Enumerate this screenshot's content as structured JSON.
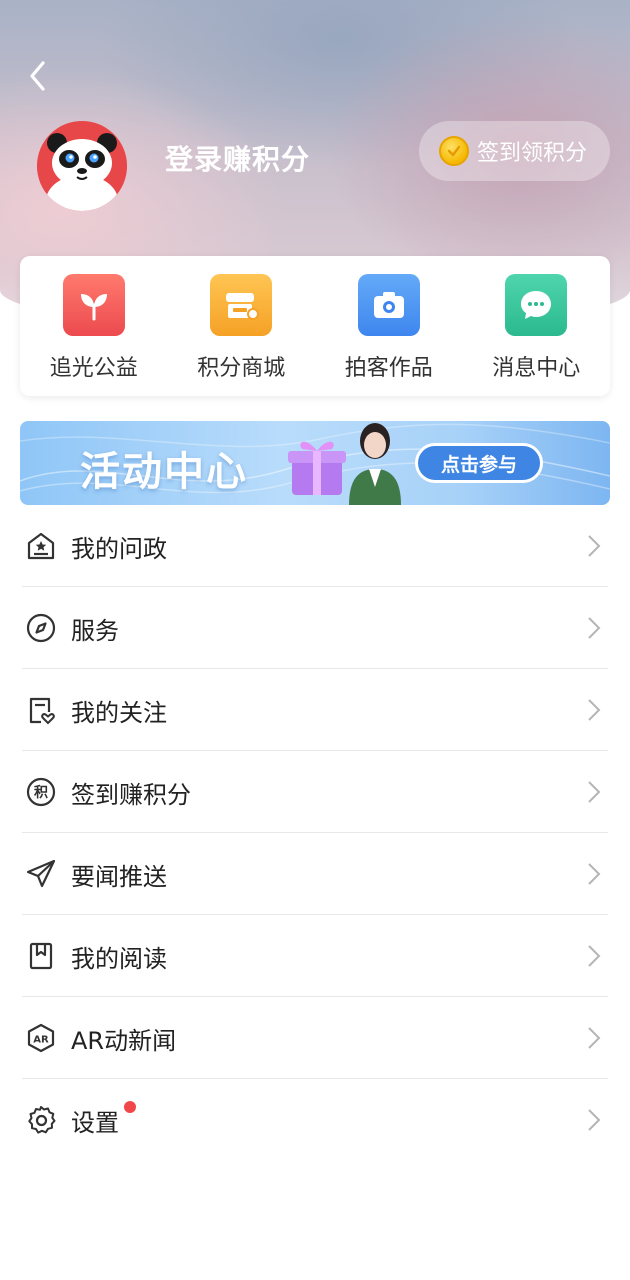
{
  "header": {
    "login_text": "登录赚积分",
    "checkin_label": "签到领积分"
  },
  "quick_links": [
    {
      "label": "追光公益",
      "icon": "sprout-icon",
      "color": "#f0595a"
    },
    {
      "label": "积分商城",
      "icon": "shop-icon",
      "color": "#f7b03a"
    },
    {
      "label": "拍客作品",
      "icon": "camera-icon",
      "color": "#4b96f3"
    },
    {
      "label": "消息中心",
      "icon": "chat-icon",
      "color": "#35c29a"
    }
  ],
  "banner": {
    "title": "活动中心",
    "button_label": "点击参与"
  },
  "menu": [
    {
      "label": "我的问政",
      "icon": "house-star-icon"
    },
    {
      "label": "服务",
      "icon": "compass-icon"
    },
    {
      "label": "我的关注",
      "icon": "follow-heart-icon"
    },
    {
      "label": "签到赚积分",
      "icon": "points-icon",
      "icon_text": "积"
    },
    {
      "label": "要闻推送",
      "icon": "send-icon"
    },
    {
      "label": "我的阅读",
      "icon": "bookmark-icon"
    },
    {
      "label": "AR动新闻",
      "icon": "ar-icon",
      "icon_text": "AR"
    },
    {
      "label": "设置",
      "icon": "gear-icon",
      "badge": true
    }
  ]
}
